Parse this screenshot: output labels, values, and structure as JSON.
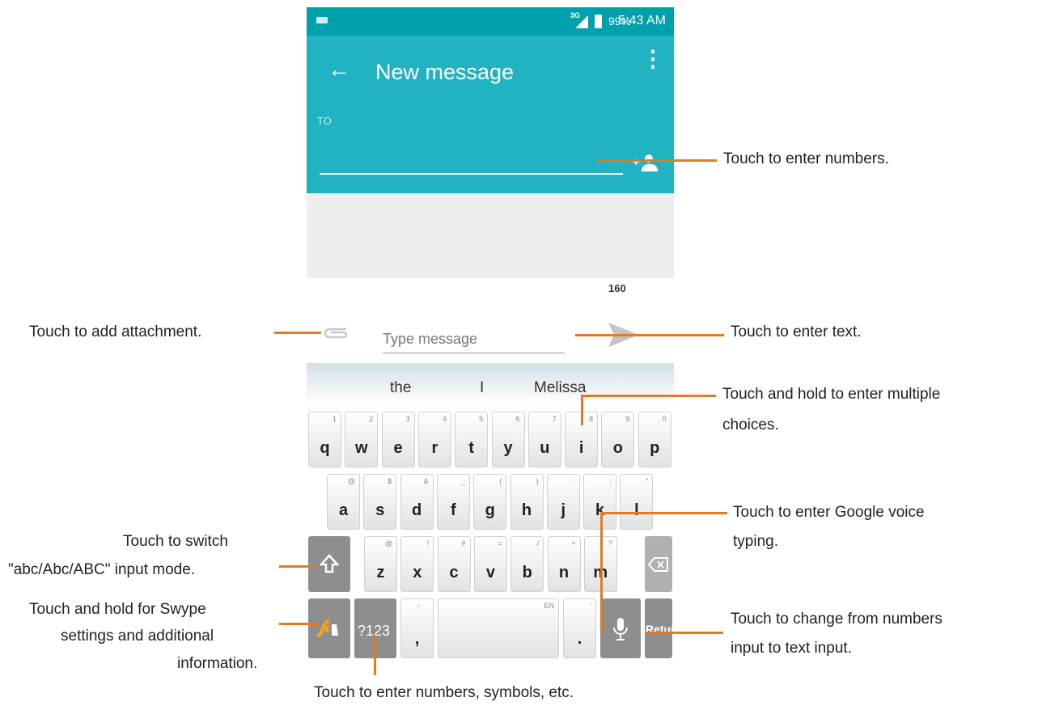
{
  "status_bar": {
    "network": "3G",
    "battery": "99%",
    "time": "5:43 AM"
  },
  "app_bar": {
    "title": "New message",
    "to_label": "TO"
  },
  "compose": {
    "char_count": "160",
    "placeholder": "Type message"
  },
  "suggestions": [
    "the",
    "I",
    "Melissa"
  ],
  "keyboard": {
    "row1": [
      {
        "key": "q",
        "sub": "1"
      },
      {
        "key": "w",
        "sub": "2"
      },
      {
        "key": "e",
        "sub": "3"
      },
      {
        "key": "r",
        "sub": "4"
      },
      {
        "key": "t",
        "sub": "5"
      },
      {
        "key": "y",
        "sub": "6"
      },
      {
        "key": "u",
        "sub": "7"
      },
      {
        "key": "i",
        "sub": "8"
      },
      {
        "key": "o",
        "sub": "9"
      },
      {
        "key": "p",
        "sub": "0"
      }
    ],
    "row2": [
      {
        "key": "a",
        "sub": "@"
      },
      {
        "key": "s",
        "sub": "$"
      },
      {
        "key": "d",
        "sub": "&"
      },
      {
        "key": "f",
        "sub": "_"
      },
      {
        "key": "g",
        "sub": "("
      },
      {
        "key": "h",
        "sub": ")"
      },
      {
        "key": "j",
        "sub": ":"
      },
      {
        "key": "k",
        "sub": ";"
      },
      {
        "key": "l",
        "sub": "\""
      }
    ],
    "row3": [
      {
        "key": "z",
        "sub": "@"
      },
      {
        "key": "x",
        "sub": "!"
      },
      {
        "key": "c",
        "sub": "#"
      },
      {
        "key": "v",
        "sub": "="
      },
      {
        "key": "b",
        "sub": "/"
      },
      {
        "key": "n",
        "sub": "+"
      },
      {
        "key": "m",
        "sub": "?"
      }
    ],
    "numbers_key": "?123",
    "comma_key": ",",
    "comma_sub": "-",
    "space_sub": "EN",
    "period_key": ".",
    "period_sub": "'",
    "return_key": "Return"
  },
  "annotations": {
    "numbers": "Touch to enter numbers.",
    "attachment": "Touch to add attachment.",
    "text": "Touch to enter text.",
    "multiple_1": "Touch and hold to enter multiple",
    "multiple_2": "choices.",
    "voice_1": "Touch to enter Google voice",
    "voice_2": "typing.",
    "switch_1": "Touch to switch",
    "switch_2": "\"abc/Abc/ABC\" input mode.",
    "swype_1": "Touch and hold for Swype",
    "swype_2": "settings and additional",
    "swype_3": "information.",
    "change_1": "Touch to change from numbers",
    "change_2": "input to text input.",
    "symbols": "Touch to enter numbers, symbols, etc."
  },
  "colors": {
    "teal": "#22b3c3",
    "status_teal": "#00a0ad",
    "callout": "#e67a20",
    "dark_key": "#8e8e8e"
  }
}
